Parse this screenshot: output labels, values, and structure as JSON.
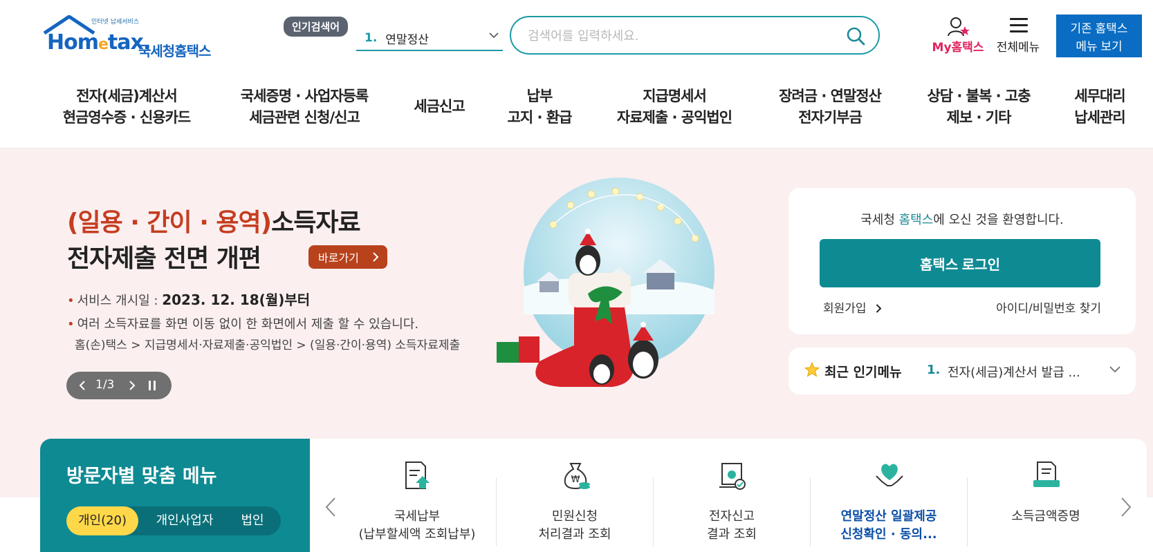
{
  "colors": {
    "brand_teal": "#0e8a93",
    "brand_blue": "#0a6cc2",
    "my_hometax_pink": "#e0245e",
    "hero_bg": "#fbeff0",
    "hero_highlight": "#c53d1f",
    "tab_active": "#ffd84a"
  },
  "header": {
    "logo_small": "인터넷 납세서비스",
    "logo_text": "Hom",
    "logo_text_e": "e",
    "logo_text_tail": "tax.",
    "logo_kor": "국세청홈택스",
    "popular_tag": "인기검색어",
    "popular_num": "1.",
    "popular_value": "연말정산",
    "search_placeholder": "검색어를 입력하세요.",
    "my_hometax": "My홈택스",
    "full_menu": "전체메뉴",
    "old_menu_line1": "기존 홈택스",
    "old_menu_line2": "메뉴 보기"
  },
  "gnb": [
    {
      "l1": "전자(세금)계산서",
      "l2": "현금영수증 · 신용카드"
    },
    {
      "l1": "국세증명 · 사업자등록",
      "l2": "세금관련 신청/신고"
    },
    {
      "l1": "세금신고",
      "l2": ""
    },
    {
      "l1": "납부",
      "l2": "고지 · 환급"
    },
    {
      "l1": "지급명세서",
      "l2": "자료제출 · 공익법인"
    },
    {
      "l1": "장려금 · 연말정산",
      "l2": "전자기부금"
    },
    {
      "l1": "상담 · 불복 · 고충",
      "l2": "제보 · 기타"
    },
    {
      "l1": "세무대리",
      "l2": "납세관리"
    }
  ],
  "hero": {
    "title_highlight": "(일용 · 간이 · 용역)",
    "title_rest": "소득자료",
    "title_line2": "전자제출 전면 개편",
    "go_button": "바로가기",
    "bullet1_label": "서비스 개시일 : ",
    "bullet1_value": "2023. 12. 18(월)부터",
    "bullet2": "여러 소득자료를 화면 이동 없이 한 화면에서 제출 할 수 있습니다.",
    "path": "홈(손)택스 > 지급명세서·자료제출·공익법인 > (일용·간이·용역) 소득자료제출",
    "slide_counter": "1/3"
  },
  "login": {
    "welcome_pre": "국세청 ",
    "welcome_hl": "홈택스",
    "welcome_post": "에 오신 것을 환영합니다.",
    "login_button": "홈택스 로그인",
    "join": "회원가입",
    "find": "아이디/비밀번호 찾기"
  },
  "recent": {
    "title": "최근 인기메뉴",
    "num": "1.",
    "item": "전자(세금)계산서 발급 ..."
  },
  "visitor": {
    "title": "방문자별 맞춤 메뉴",
    "tabs": [
      "개인(20)",
      "개인사업자",
      "법인"
    ]
  },
  "quick": [
    {
      "l1": "국세납부",
      "l2": "(납부할세액 조회납부)",
      "icon": "tax-payment-icon"
    },
    {
      "l1": "민원신청",
      "l2": "처리결과 조회",
      "icon": "money-bag-icon"
    },
    {
      "l1": "전자신고",
      "l2": "결과 조회",
      "icon": "certificate-icon"
    },
    {
      "l1": "연말정산 일괄제공",
      "l2": "신청확인 · 동의...",
      "icon": "heart-hands-icon"
    },
    {
      "l1": "소득금액증명",
      "l2": "",
      "icon": "document-stack-icon"
    }
  ]
}
